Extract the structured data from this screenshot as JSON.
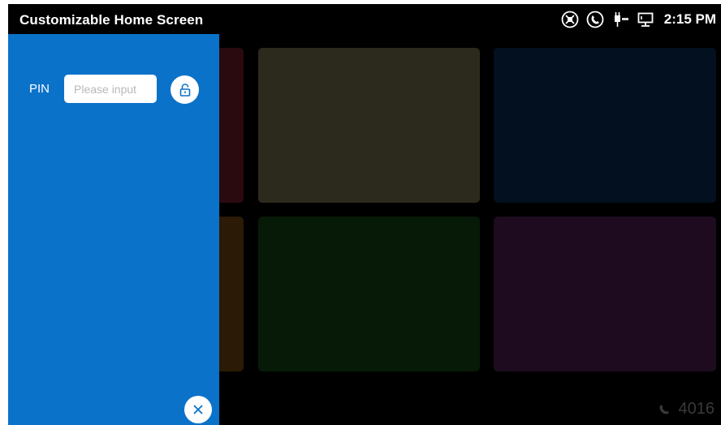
{
  "status_bar": {
    "title": "Customizable Home Screen",
    "icons": [
      "network-disconnected-icon",
      "phone-icon",
      "poe-power-icon",
      "desktop-connection-icon"
    ],
    "time": "2:15 PM",
    "text_color": "#ffffff"
  },
  "tiles": [
    {
      "name": "tile-1",
      "color": "#2a0a0e"
    },
    {
      "name": "tile-2",
      "color": "#2b2a1d"
    },
    {
      "name": "tile-3",
      "color": "#02101f"
    },
    {
      "name": "tile-4",
      "color": "#2b1a06"
    },
    {
      "name": "tile-5",
      "color": "#061a07"
    },
    {
      "name": "tile-6",
      "color": "#1e0b1f"
    }
  ],
  "extension": {
    "icon": "phone-handset-icon",
    "number": "4016"
  },
  "side_panel": {
    "background": "#0b72c9",
    "pin_label": "PIN",
    "pin_input": {
      "value": "",
      "placeholder": "Please input"
    },
    "unlock_icon": "unlock-icon",
    "close_icon": "close-icon"
  }
}
